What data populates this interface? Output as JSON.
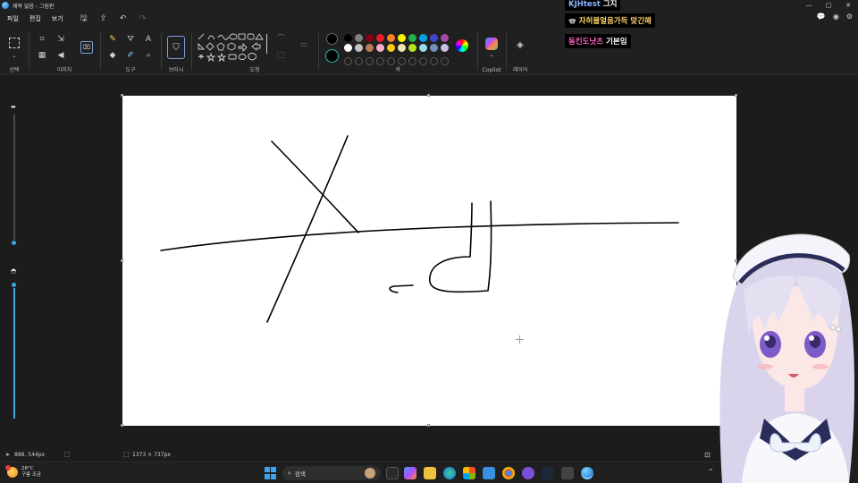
{
  "window": {
    "title": "제목 없음 - 그림판",
    "controls": {
      "minimize": "—",
      "maximize": "▢",
      "close": "✕"
    }
  },
  "menu": {
    "items": [
      "파일",
      "편집",
      "보기"
    ]
  },
  "ribbon": {
    "groups": {
      "select": "선택",
      "image": "이미지",
      "tools": "도구",
      "brushes": "브러시",
      "shapes": "도형",
      "colors": "색",
      "copilot": "Copilot",
      "layers": "레이어"
    }
  },
  "palette": {
    "primary": "#000000",
    "secondary": "#ffffff",
    "row1": [
      "#000000",
      "#7f7f7f",
      "#880015",
      "#ed1c24",
      "#ff7f27",
      "#fff200",
      "#22b14c",
      "#00a2e8",
      "#3f48cc",
      "#a349a4"
    ],
    "row2": [
      "#ffffff",
      "#c3c3c3",
      "#b97a57",
      "#ffaec9",
      "#ffc90e",
      "#efe4b0",
      "#b5e61d",
      "#99d9ea",
      "#7092be",
      "#c8bfe7"
    ]
  },
  "status": {
    "cursor_position": "888, 544px",
    "canvas_size": "1373 × 737px"
  },
  "taskbar": {
    "temperature": "28°C",
    "weather_desc": "구름 조금",
    "search_placeholder": "검색"
  },
  "chat": [
    {
      "user": "KJHtest",
      "message": "그지",
      "user_color": "#8fb4ff"
    },
    {
      "user": "",
      "message": "자허블얼음가득 맞긴해",
      "user_color": "#ffd36b",
      "badge": "🐨"
    },
    {
      "user": "동킨도냣츠",
      "message": "기본임",
      "user_color": "#ff66c4"
    }
  ],
  "sliders": {
    "size_level": 0.02,
    "opacity_level": 1.0
  }
}
